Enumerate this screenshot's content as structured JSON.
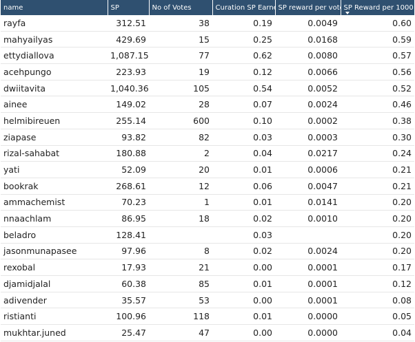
{
  "table": {
    "columns": [
      {
        "label": "name",
        "align": "left"
      },
      {
        "label": "SP",
        "align": "right"
      },
      {
        "label": "No of Votes",
        "align": "right"
      },
      {
        "label": "Curation SP Earned",
        "align": "right"
      },
      {
        "label": "SP reward per vote",
        "align": "right"
      },
      {
        "label": "SP Reward per 1000 SP",
        "align": "right",
        "sorted": "descending"
      }
    ],
    "rows": [
      [
        "rayfa",
        "312.51",
        "38",
        "0.19",
        "0.0049",
        "0.60"
      ],
      [
        "mahyailyas",
        "429.69",
        "15",
        "0.25",
        "0.0168",
        "0.59"
      ],
      [
        "ettydiallova",
        "1,087.15",
        "77",
        "0.62",
        "0.0080",
        "0.57"
      ],
      [
        "acehpungo",
        "223.93",
        "19",
        "0.12",
        "0.0066",
        "0.56"
      ],
      [
        "dwiitavita",
        "1,040.36",
        "105",
        "0.54",
        "0.0052",
        "0.52"
      ],
      [
        "ainee",
        "149.02",
        "28",
        "0.07",
        "0.0024",
        "0.46"
      ],
      [
        "helmibireuen",
        "255.14",
        "600",
        "0.10",
        "0.0002",
        "0.38"
      ],
      [
        "ziapase",
        "93.82",
        "82",
        "0.03",
        "0.0003",
        "0.30"
      ],
      [
        "rizal-sahabat",
        "180.88",
        "2",
        "0.04",
        "0.0217",
        "0.24"
      ],
      [
        "yati",
        "52.09",
        "20",
        "0.01",
        "0.0006",
        "0.21"
      ],
      [
        "bookrak",
        "268.61",
        "12",
        "0.06",
        "0.0047",
        "0.21"
      ],
      [
        "ammachemist",
        "70.23",
        "1",
        "0.01",
        "0.0141",
        "0.20"
      ],
      [
        "nnaachlam",
        "86.95",
        "18",
        "0.02",
        "0.0010",
        "0.20"
      ],
      [
        "beladro",
        "128.41",
        "",
        "0.03",
        "",
        "0.20"
      ],
      [
        "jasonmunapasee",
        "97.96",
        "8",
        "0.02",
        "0.0024",
        "0.20"
      ],
      [
        "rexobal",
        "17.93",
        "21",
        "0.00",
        "0.0001",
        "0.17"
      ],
      [
        "djamidjalal",
        "60.38",
        "85",
        "0.01",
        "0.0001",
        "0.12"
      ],
      [
        "adivender",
        "35.57",
        "53",
        "0.00",
        "0.0001",
        "0.08"
      ],
      [
        "ristianti",
        "100.96",
        "118",
        "0.01",
        "0.0000",
        "0.05"
      ],
      [
        "mukhtar.juned",
        "25.47",
        "47",
        "0.00",
        "0.0000",
        "0.04"
      ]
    ]
  },
  "icons": {
    "sort_indicator": "sort-descending-icon"
  }
}
